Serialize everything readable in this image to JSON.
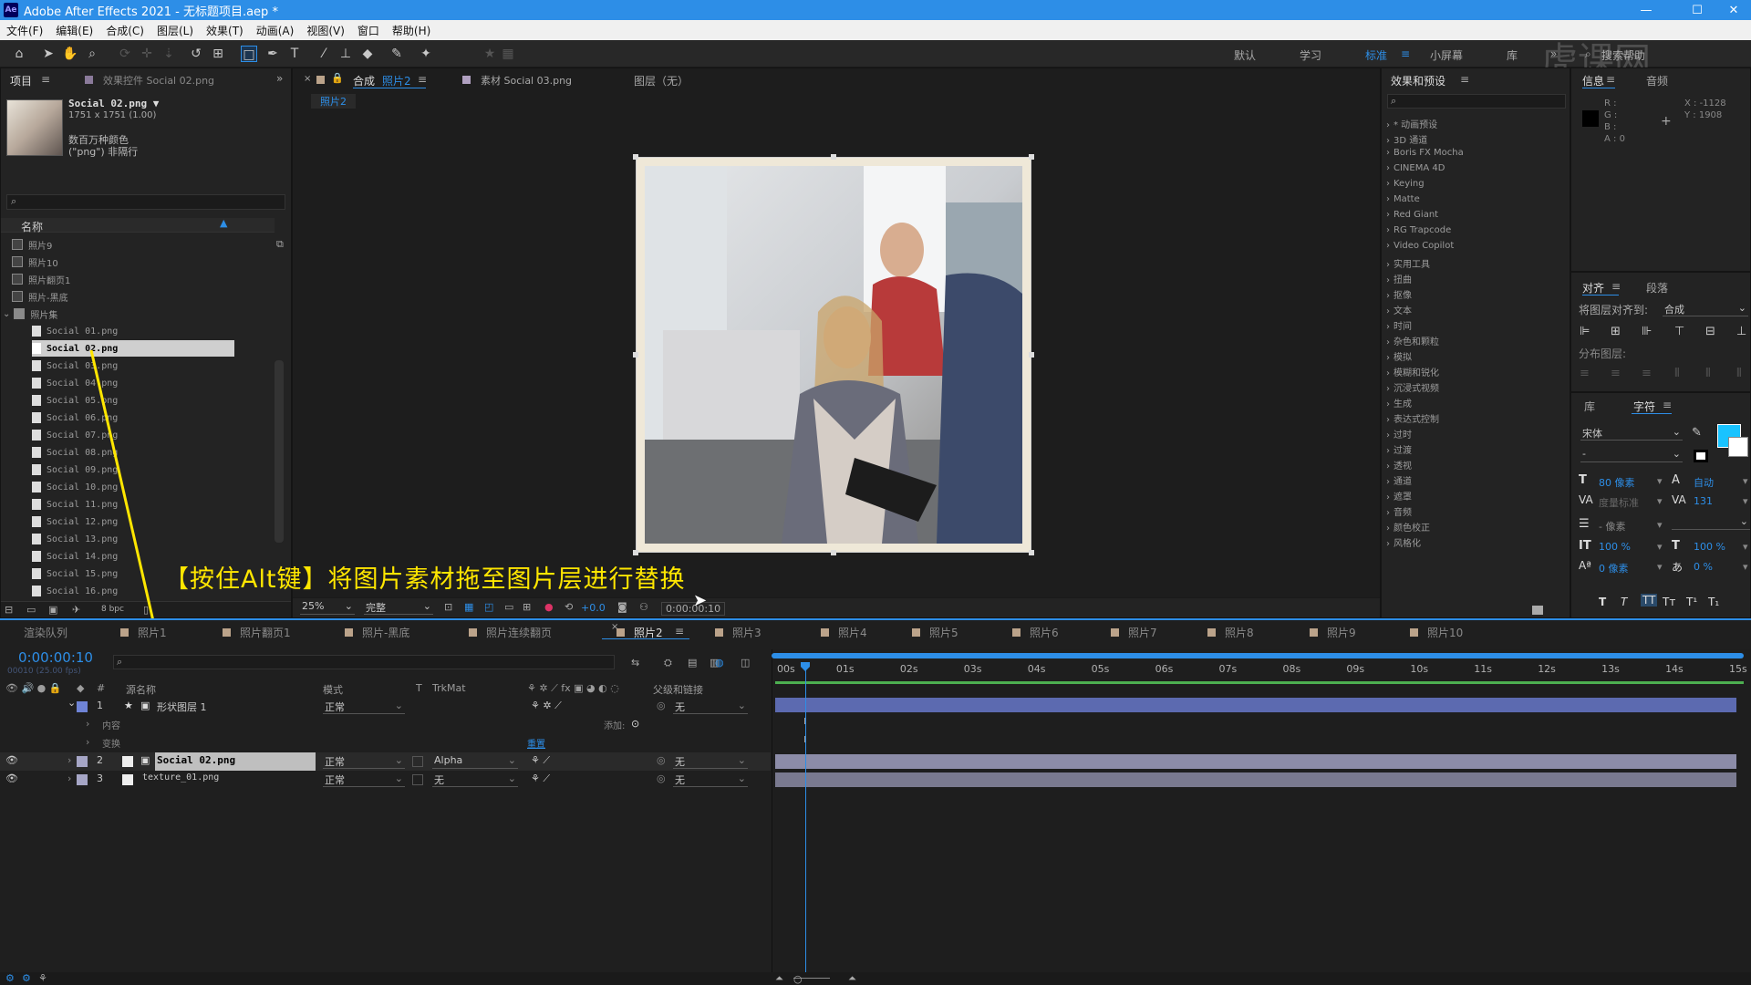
{
  "app": {
    "title": "Adobe After Effects 2021 - 无标题项目.aep *",
    "logo": "Ae"
  },
  "menu": [
    "文件(F)",
    "编辑(E)",
    "合成(C)",
    "图层(L)",
    "效果(T)",
    "动画(A)",
    "视图(V)",
    "窗口",
    "帮助(H)"
  ],
  "workspaces": [
    "默认",
    "学习",
    "标准",
    "小屏幕",
    "库"
  ],
  "search_help": "搜索帮助",
  "watermark": "虎课网",
  "project": {
    "tab": "项目",
    "tab2": "效果控件 Social 02.png",
    "file_name": "Social 02.png ▼",
    "file_dims": "1751 x 1751 (1.00)",
    "file_color": "数百万种颜色",
    "file_alpha": "(\"png\") 非隔行",
    "col_name": "名称",
    "folders": [
      "照片9",
      "照片10",
      "照片翻页1",
      "照片-黑底",
      "照片集"
    ],
    "files": [
      "Social 01.png",
      "Social 02.png",
      "Social 03.png",
      "Social 04.png",
      "Social 05.png",
      "Social 06.png",
      "Social 07.png",
      "Social 08.png",
      "Social 09.png",
      "Social 10.png",
      "Social 11.png",
      "Social 12.png",
      "Social 13.png",
      "Social 14.png",
      "Social 15.png",
      "Social 16.png"
    ],
    "bpc": "8 bpc"
  },
  "viewer": {
    "tab_comp": "合成",
    "tab_comp_name": "照片2",
    "tab_footage": "素材 Social 03.png",
    "tab_layer": "图层（无）",
    "breadcrumb": "照片2",
    "zoom": "25%",
    "quality": "完整",
    "exposure": "+0.0",
    "timecode": "0:00:00:10"
  },
  "caption": "【按住Alt键】将图片素材拖至图片层进行替换",
  "effects": {
    "tab": "效果和预设",
    "items": [
      "* 动画预设",
      "3D 通道",
      "Boris FX Mocha",
      "CINEMA 4D",
      "Keying",
      "Matte",
      "Red Giant",
      "RG Trapcode",
      "Video Copilot",
      "实用工具",
      "扭曲",
      "抠像",
      "文本",
      "时间",
      "杂色和颗粒",
      "模拟",
      "模糊和锐化",
      "沉浸式视频",
      "生成",
      "表达式控制",
      "过时",
      "过渡",
      "透视",
      "通道",
      "遮罩",
      "音频",
      "颜色校正",
      "风格化"
    ]
  },
  "info": {
    "tab": "信息",
    "tab2": "音频",
    "r": "R :",
    "g": "G :",
    "b": "B :",
    "a": "A : 0",
    "x": "X : -1128",
    "y": "Y : 1908"
  },
  "align": {
    "tab": "对齐",
    "tab2": "段落",
    "align_to_label": "将图层对齐到:",
    "align_to_value": "合成",
    "distribute": "分布图层:"
  },
  "char": {
    "tab_lib": "库",
    "tab": "字符",
    "font": "宋体",
    "style": "-",
    "size": "80 像素",
    "leading": "自动",
    "kerning": "度量标准",
    "tracking": "131",
    "stroke": "- 像素",
    "vscale": "100 %",
    "hscale": "100 %",
    "baseline": "0 像素",
    "tsume": "0 %",
    "accent": "#19c3ff"
  },
  "timeline": {
    "tabs": [
      "渲染队列",
      "照片1",
      "照片翻页1",
      "照片-黑底",
      "照片连续翻页",
      "照片2",
      "照片3",
      "照片4",
      "照片5",
      "照片6",
      "照片7",
      "照片8",
      "照片9",
      "照片10"
    ],
    "active_tab": "照片2",
    "timecode": "0:00:00:10",
    "fps": "00010 (25.00 fps)",
    "cols": {
      "src": "源名称",
      "mode": "模式",
      "t": "T",
      "trkmat": "TrkMat",
      "parent": "父级和链接"
    },
    "ticks": [
      "00s",
      "01s",
      "02s",
      "03s",
      "04s",
      "05s",
      "06s",
      "07s",
      "08s",
      "09s",
      "10s",
      "11s",
      "12s",
      "13s",
      "14s",
      "15s"
    ],
    "playhead_seconds": 0.4,
    "layers": [
      {
        "num": "1",
        "name": "形状图层 1",
        "mode": "正常",
        "trkmat": "",
        "parent": "无",
        "color": "#6f84d6"
      },
      {
        "num": "2",
        "name": "Social 02.png",
        "mode": "正常",
        "trkmat": "Alpha",
        "parent": "无",
        "color": "#a6a6c6"
      },
      {
        "num": "3",
        "name": "texture_01.png",
        "mode": "正常",
        "trkmat": "无",
        "parent": "无",
        "color": "#a6a6c6"
      }
    ],
    "sub_content": "内容",
    "sub_add": "添加:",
    "sub_transform": "变换",
    "sub_reset": "重置"
  }
}
